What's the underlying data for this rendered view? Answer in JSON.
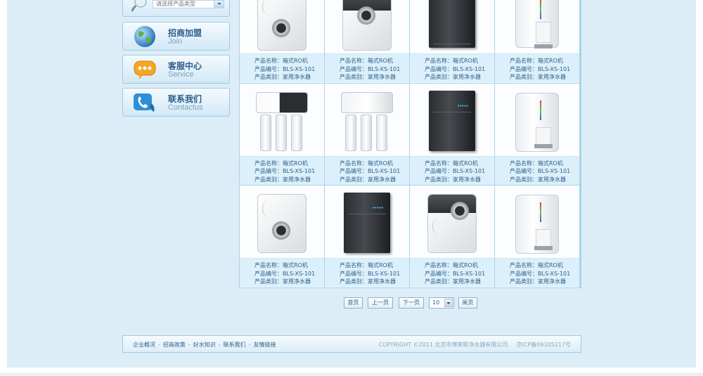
{
  "sidebar": {
    "search_placeholder": "请选择产品类型",
    "buttons": [
      {
        "title": "招商加盟",
        "subtitle": "Join"
      },
      {
        "title": "客服中心",
        "subtitle": "Service"
      },
      {
        "title": "联系我们",
        "subtitle": "Contactus"
      }
    ]
  },
  "products": [
    {
      "name": "产品名称：箱式RO机",
      "code": "产品编号：BLS-XS-101",
      "category": "产品类别：家用净水器",
      "image": "white-ring-purifier"
    },
    {
      "name": "产品名称：箱式RO机",
      "code": "产品编号：BLS-XS-101",
      "category": "产品类别：家用净水器",
      "image": "silver-ring-purifier"
    },
    {
      "name": "产品名称：箱式RO机",
      "code": "产品编号：BLS-XS-101",
      "category": "产品类别：家用净水器",
      "image": "black-cabinet-purifier"
    },
    {
      "name": "产品名称：箱式RO机",
      "code": "产品编号：BLS-XS-101",
      "category": "产品类别：家用净水器",
      "image": "white-dispenser-purifier"
    },
    {
      "name": "产品名称：箱式RO机",
      "code": "产品编号：BLS-XS-101",
      "category": "产品类别：家用净水器",
      "image": "black-head-filter-purifier"
    },
    {
      "name": "产品名称：箱式RO机",
      "code": "产品编号：BLS-XS-101",
      "category": "产品类别：家用净水器",
      "image": "white-head-filter-purifier"
    },
    {
      "name": "产品名称：箱式RO机",
      "code": "产品编号：BLS-XS-101",
      "category": "产品类别：家用净水器",
      "image": "black-cabinet-purifier"
    },
    {
      "name": "产品名称：箱式RO机",
      "code": "产品编号：BLS-XS-101",
      "category": "产品类别：家用净水器",
      "image": "white-dispenser-purifier"
    },
    {
      "name": "产品名称：箱式RO机",
      "code": "产品编号：BLS-XS-101",
      "category": "产品类别：家用净水器",
      "image": "white-ring-purifier"
    },
    {
      "name": "产品名称：箱式RO机",
      "code": "产品编号：BLS-XS-101",
      "category": "产品类别：家用净水器",
      "image": "black-cabinet-purifier"
    },
    {
      "name": "产品名称：箱式RO机",
      "code": "产品编号：BLS-XS-101",
      "category": "产品类别：家用净水器",
      "image": "silver-ring-purifier"
    },
    {
      "name": "产品名称：箱式RO机",
      "code": "产品编号：BLS-XS-101",
      "category": "产品类别：家用净水器",
      "image": "white-dispenser-purifier"
    }
  ],
  "pagination": {
    "first": "首页",
    "prev": "上一页",
    "next": "下一页",
    "page_size": "10",
    "last": "尾页"
  },
  "footer": {
    "links": [
      "企业概况",
      "招商政策",
      "好水知识",
      "联系我们",
      "友情链接"
    ],
    "separator": "-",
    "copyright": "COPYRIGHT ©2011 北京市博莱斯净水器有限公司",
    "icp": "京ICP备09105217号"
  }
}
